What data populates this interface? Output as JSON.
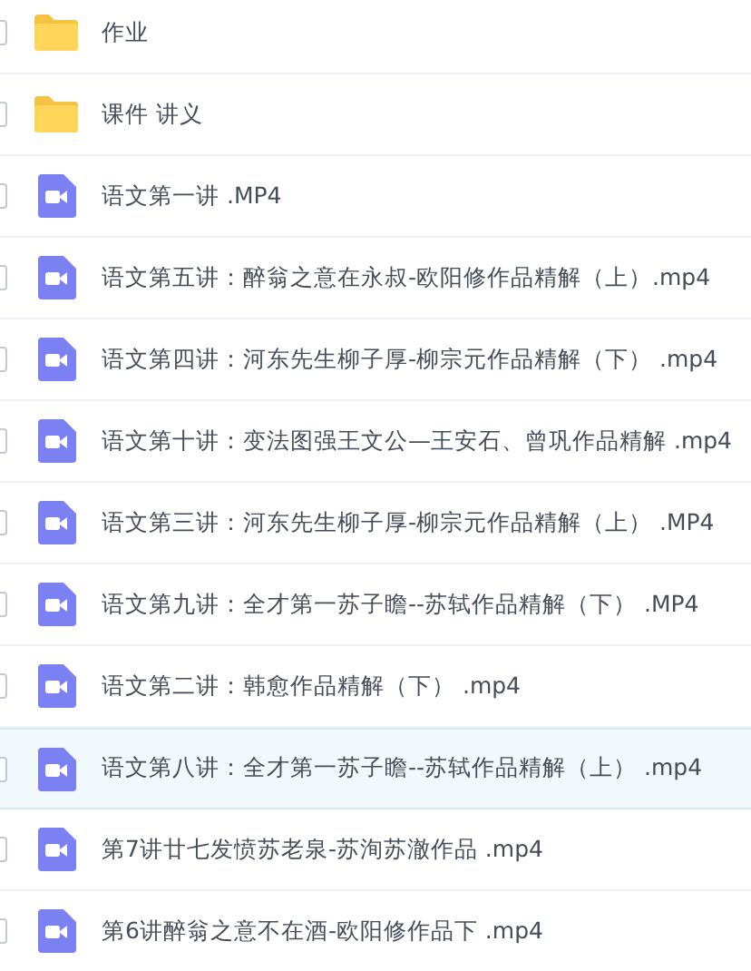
{
  "files": [
    {
      "kind": "folder",
      "name": "作业",
      "checked": false,
      "selected": false
    },
    {
      "kind": "folder",
      "name": "课件 讲义",
      "checked": false,
      "selected": false
    },
    {
      "kind": "video",
      "name": "语文第一讲 .MP4",
      "checked": false,
      "selected": false
    },
    {
      "kind": "video",
      "name": "语文第五讲：醉翁之意在永叔-欧阳修作品精解（上）.mp4",
      "checked": false,
      "selected": false
    },
    {
      "kind": "video",
      "name": "语文第四讲：河东先生柳子厚-柳宗元作品精解（下） .mp4",
      "checked": false,
      "selected": false
    },
    {
      "kind": "video",
      "name": "语文第十讲：变法图强王文公—王安石、曾巩作品精解 .mp4",
      "checked": false,
      "selected": false
    },
    {
      "kind": "video",
      "name": "语文第三讲：河东先生柳子厚-柳宗元作品精解（上） .MP4",
      "checked": false,
      "selected": false
    },
    {
      "kind": "video",
      "name": "语文第九讲：全才第一苏子瞻--苏轼作品精解（下） .MP4",
      "checked": false,
      "selected": false
    },
    {
      "kind": "video",
      "name": "语文第二讲：韩愈作品精解（下） .mp4",
      "checked": false,
      "selected": false
    },
    {
      "kind": "video",
      "name": "语文第八讲：全才第一苏子瞻--苏轼作品精解（上） .mp4",
      "checked": false,
      "selected": true
    },
    {
      "kind": "video",
      "name": "第7讲廿七发愤苏老泉-苏洵苏澈作品 .mp4",
      "checked": false,
      "selected": false
    },
    {
      "kind": "video",
      "name": "第6讲醉翁之意不在酒-欧阳修作品下 .mp4",
      "checked": false,
      "selected": false
    }
  ]
}
